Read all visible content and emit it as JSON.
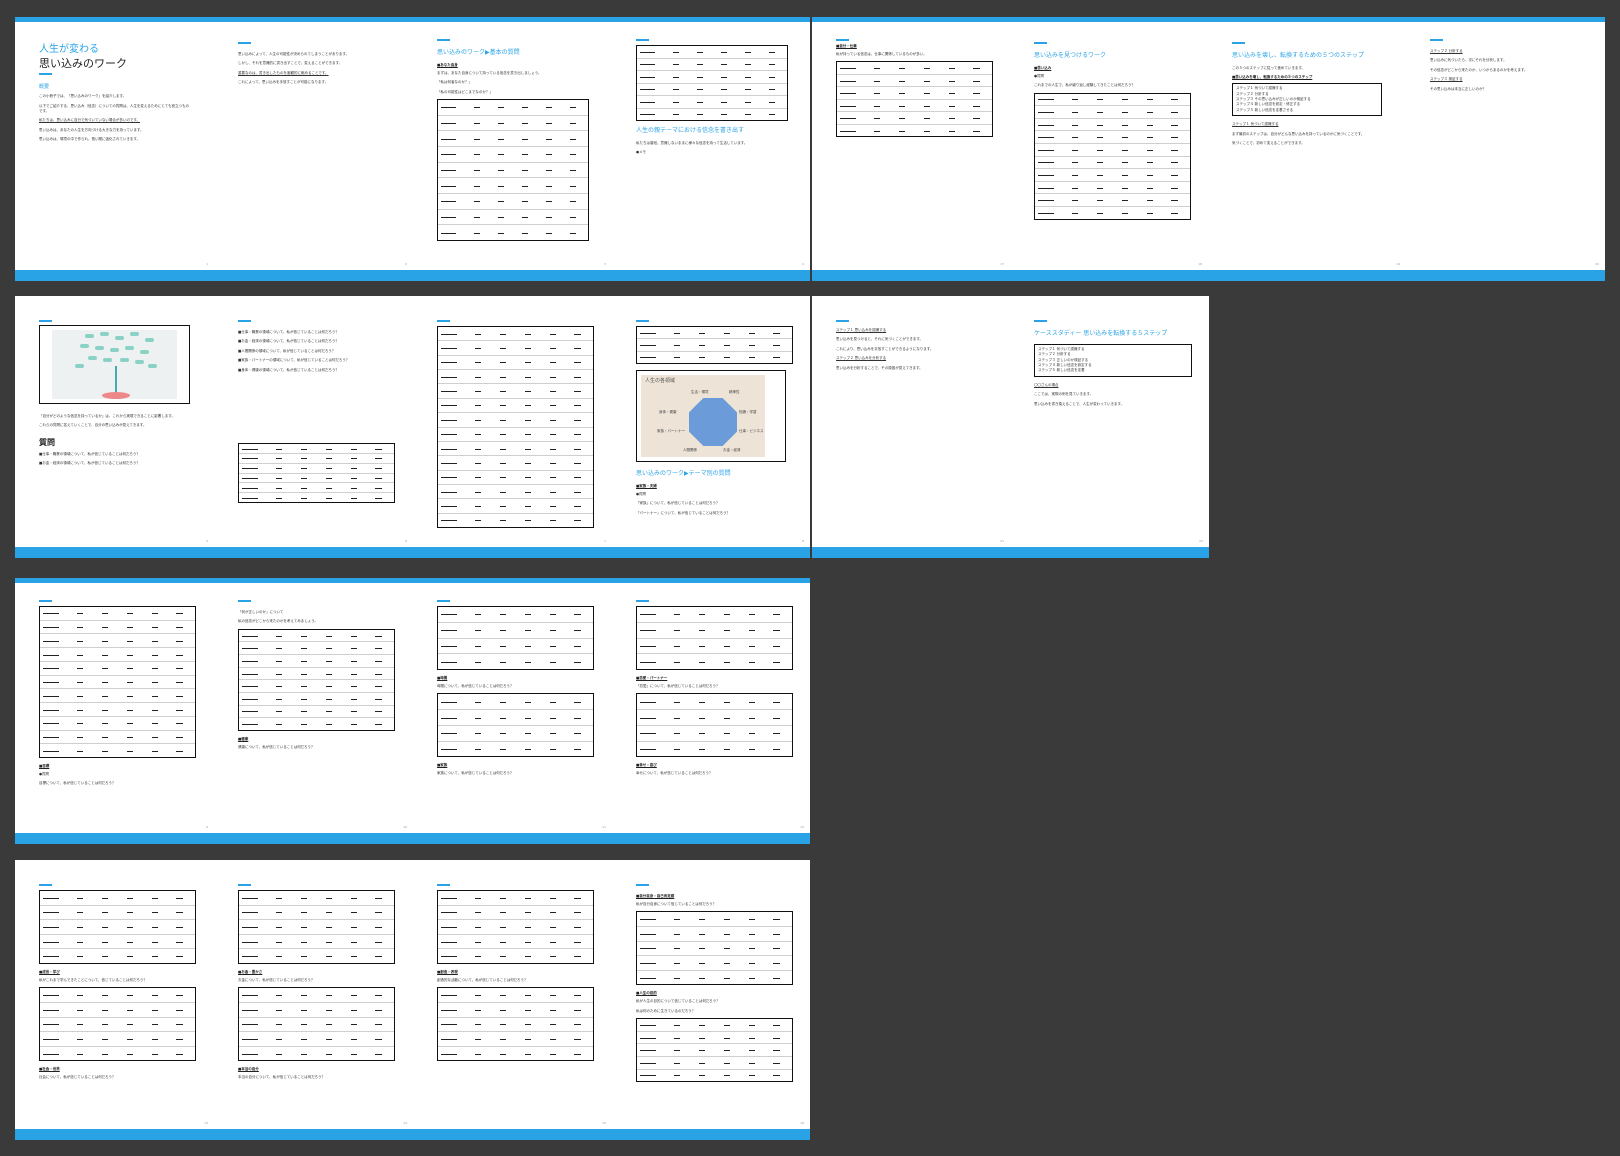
{
  "viewer": {
    "background": "#3a3a3a",
    "accent": "#29a3e6"
  },
  "doc": {
    "title_main": "人生が変わる",
    "title_sub": "思い込みのワーク",
    "overview_label": "概要",
    "tree_heading": "質問",
    "theme_heading": "人生の親テーマにおける信念を書き出す",
    "basic_heading": "思い込みのワーク▶基本の質問",
    "basic_heading2": "思い込みのワーク▶テーマ別の質問",
    "life_areas_title": "人生の各領域",
    "steps_heading": "思い込みを壊し、転換するための５つのステップ",
    "seek_heading": "思い込みを見つけるワーク",
    "case_heading": "ケーススタディー 思い込みを転換する５ステップ"
  },
  "octagon": {
    "labels": [
      "生活・環境",
      "精神性",
      "知識・学習",
      "仕事・ビジネス",
      "お金・経済",
      "人間関係",
      "家族・パートナー",
      "身体・健康"
    ]
  },
  "steps": [
    "ステップ１ 気づいて認識する",
    "ステップ２ 分析する",
    "ステップ３ その思い込みが正しいのか検証する",
    "ステップ４ 新しい信念を設定・修正する",
    "ステップ５ 新しい信念を定着させる"
  ],
  "case_steps": [
    "ステップ１ 気づいて認識する",
    "ステップ２ 分析する",
    "ステップ３ 正しいのか検証する",
    "ステップ４ 新しい信念を設定する",
    "ステップ５ 新しい信念を定着"
  ],
  "page_numbers": [
    "1",
    "2",
    "3",
    "4",
    "17",
    "18",
    "19",
    "20",
    "5",
    "6",
    "7",
    "8",
    "21",
    "22",
    "9",
    "10",
    "11",
    "12",
    "13",
    "14",
    "15",
    "16"
  ],
  "text": {
    "p1_1": "この小冊子では、「思い込みのワーク」を紹介します。",
    "p1_2": "以下でご紹介する、思い込み（信念）についての質問は、人生を変えるためにとても役立つものです。",
    "p1_u": "私たちは、思い込みに自分で気づいていない場合が多いのです。",
    "p1_3": "思い込みは、あなたの人生を方向づける大きな力を持っています。",
    "p1_4": "思い込みは、環境の中で作られ、長い間に強化されていきます。",
    "p2_1": "思い込みによって、人生の可能性が決められてしまうことがあります。",
    "p2_2": "しかし、それを意識的に書き出すことで、変えることができます。",
    "p2_u": "重要なのは、書き出したものを客観的に眺めることです。",
    "p2_3": "これによって、思い込みを手放すことが可能になります。",
    "p3_lbl": "■あなた自身",
    "p3_1": "まずは、あなた自身について持っている信念を書き出しましょう。",
    "p3_2": "「私は何者なのか？」",
    "p3_3": "「私の可能性はどこまでなのか？」",
    "p4_1": "私たちは普段、意識しないままに様々な信念を持って生活しています。",
    "p4_2": "●メモ",
    "p5_1": "「自分がどのような信念を持っているか」は、これから実現できることに影響します。",
    "p5_2": "これらの質問に答えていくことで、自分の思い込みが見えてきます。",
    "p6_q1": "■仕事・職業の領域について、私が信じていることは何だろう？",
    "p6_q2": "■お金・経済の領域について、私が信じていることは何だろう？",
    "p6_q3": "■人間関係の領域について、私が信じていることは何だろう？",
    "p6_q4": "■家族・パートナーの領域について、私が信じていることは何だろう？",
    "p6_q5": "■身体・健康の領域について、私が信じていることは何だろう？",
    "p8_lbl": "■家族・夫婦",
    "p8_1": "●質問",
    "p8_2": "「家族」について、私が信じていることは何だろう？",
    "p8_3": "「パートナー」について、私が信じていることは何だろう？",
    "p17_lbl": "■自分・仕事",
    "p17_1": "私が持っている信念は、仕事に関係しているものが多い。",
    "p18_lbl": "■思い込み",
    "p18_1": "●質問",
    "p18_2": "これまでの人生で、私が繰り返し経験してきたことは何だろう？",
    "p19_lbl": "■思い込みを壊し、転換するための５つのステップ",
    "p19_1": "この５つのステップに従って進めていきます。",
    "p19_u": "ステップ１ 気づいて認識する",
    "p19_2": "まず最初のステップは、自分がどんな思い込みを持っているのかに気づくことです。",
    "p19_3": "気づくことで、初めて変えることができます。",
    "p20_u": "ステップ２ 分析する",
    "p20_1": "思い込みに気づいたら、次にそれを分析します。",
    "p20_2": "その信念がどこから来たのか、いつからあるのかを考えます。",
    "p20_u2": "ステップ３ 検証する",
    "p20_3": "その思い込みは本当に正しいのか？",
    "p21_u": "ステップ１ 思い込みを認識する",
    "p21_1": "思い込みを見つけると、それに気づくことができます。",
    "p21_2": "これにより、思い込みを手放すことができるようになります。",
    "p21_u2": "ステップ２ 思い込みを分析する",
    "p21_3": "思い込みを分析することで、その原因が見えてきます。",
    "p22_u": "〇〇さんの場合",
    "p22_1": "ここでは、実際の例を見ていきます。",
    "p22_2": "思い込みを書き換えることで、人生が変わっていきます。",
    "p9_lbl": "■目標",
    "p9_1": "●質問",
    "p9_2": "目標について、私が信じていることは何だろう？",
    "p10_1": "「何が正しいのか」について",
    "p10_2": "私の信念がどこから来たのかを考えてみましょう。",
    "p10_lbl": "■健康",
    "p10_3": "健康について、私が信じていることは何だろう？",
    "p11_lbl": "■時間",
    "p11_1": "時間について、私が信じていることは何だろう？",
    "p11_lbl2": "■家族",
    "p11_2": "家族について、私が信じていることは何だろう？",
    "p12_lbl": "■恋愛・パートナー",
    "p12_1": "「恋愛」について、私が信じていることは何だろう？",
    "p12_lbl2": "■幸せ・喜び",
    "p12_2": "幸せについて、私が信じていることは何だろう？",
    "p13_lbl": "■成長・学び",
    "p13_1": "私がこれまで学んできたことについて、信じていることは何だろう？",
    "p13_lbl2": "■社会・世界",
    "p13_2": "社会について、私が信じていることは何だろう？",
    "p14_lbl": "■お金・豊かさ",
    "p14_1": "お金について、私が信じていることは何だろう？",
    "p14_lbl2": "■本当の自分",
    "p14_2": "本当の自分について、私が信じていることは何だろう？",
    "p15_lbl": "■創造・表現",
    "p15_1": "創造的な活動について、私が信じていることは何だろう？",
    "p16_lbl": "■自分自身・自己肯定感",
    "p16_1": "私が自分自身について信じていることは何だろう？",
    "p16_lbl2": "■人生の目的",
    "p16_2": "私が人生の目的について信じていることは何だろう？",
    "p16_3": "私は何のために生きているのだろう？"
  }
}
